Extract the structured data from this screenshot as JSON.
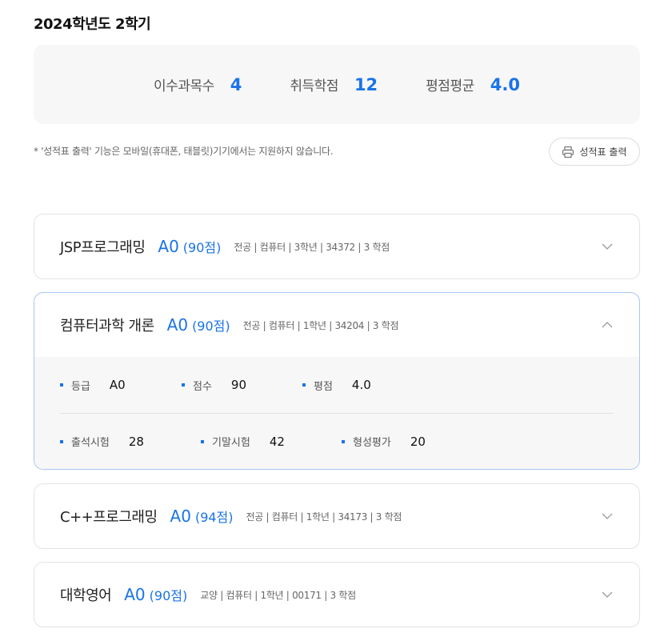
{
  "header": {
    "title": "2024학년도 2학기"
  },
  "summary": [
    {
      "label": "이수과목수",
      "value": "4"
    },
    {
      "label": "취득학점",
      "value": "12"
    },
    {
      "label": "평점평균",
      "value": "4.0"
    }
  ],
  "notice": "* '성적표 출력' 기능은 모바일(휴대폰, 태블릿)기기에서는 지원하지 않습니다.",
  "print_button": {
    "label": "성적표 출력",
    "icon": "printer-icon"
  },
  "courses": [
    {
      "name": "JSP프로그래밍",
      "grade": "A0",
      "score": "(90점)",
      "meta": "전공 | 컴퓨터 | 3학년 | 34372 | 3 학점",
      "expanded": false
    },
    {
      "name": "컴퓨터과학 개론",
      "grade": "A0",
      "score": "(90점)",
      "meta": "전공 | 컴퓨터 | 1학년 | 34204 | 3 학점",
      "expanded": true,
      "details": [
        [
          {
            "label": "등급",
            "value": "A0"
          },
          {
            "label": "점수",
            "value": "90"
          },
          {
            "label": "평점",
            "value": "4.0"
          }
        ],
        [
          {
            "label": "출석시험",
            "value": "28"
          },
          {
            "label": "기말시험",
            "value": "42"
          },
          {
            "label": "형성평가",
            "value": "20"
          }
        ]
      ]
    },
    {
      "name": "C++프로그래밍",
      "grade": "A0",
      "score": "(94점)",
      "meta": "전공 | 컴퓨터 | 1학년 | 34173 | 3 학점",
      "expanded": false
    },
    {
      "name": "대학영어",
      "grade": "A0",
      "score": "(90점)",
      "meta": "교양 | 컴퓨터 | 1학년 | 00171 | 3 학점",
      "expanded": false
    }
  ],
  "colors": {
    "accent": "#1a73e8",
    "summary_bg": "#f7f7f8",
    "open_border": "#a8c7f0"
  }
}
